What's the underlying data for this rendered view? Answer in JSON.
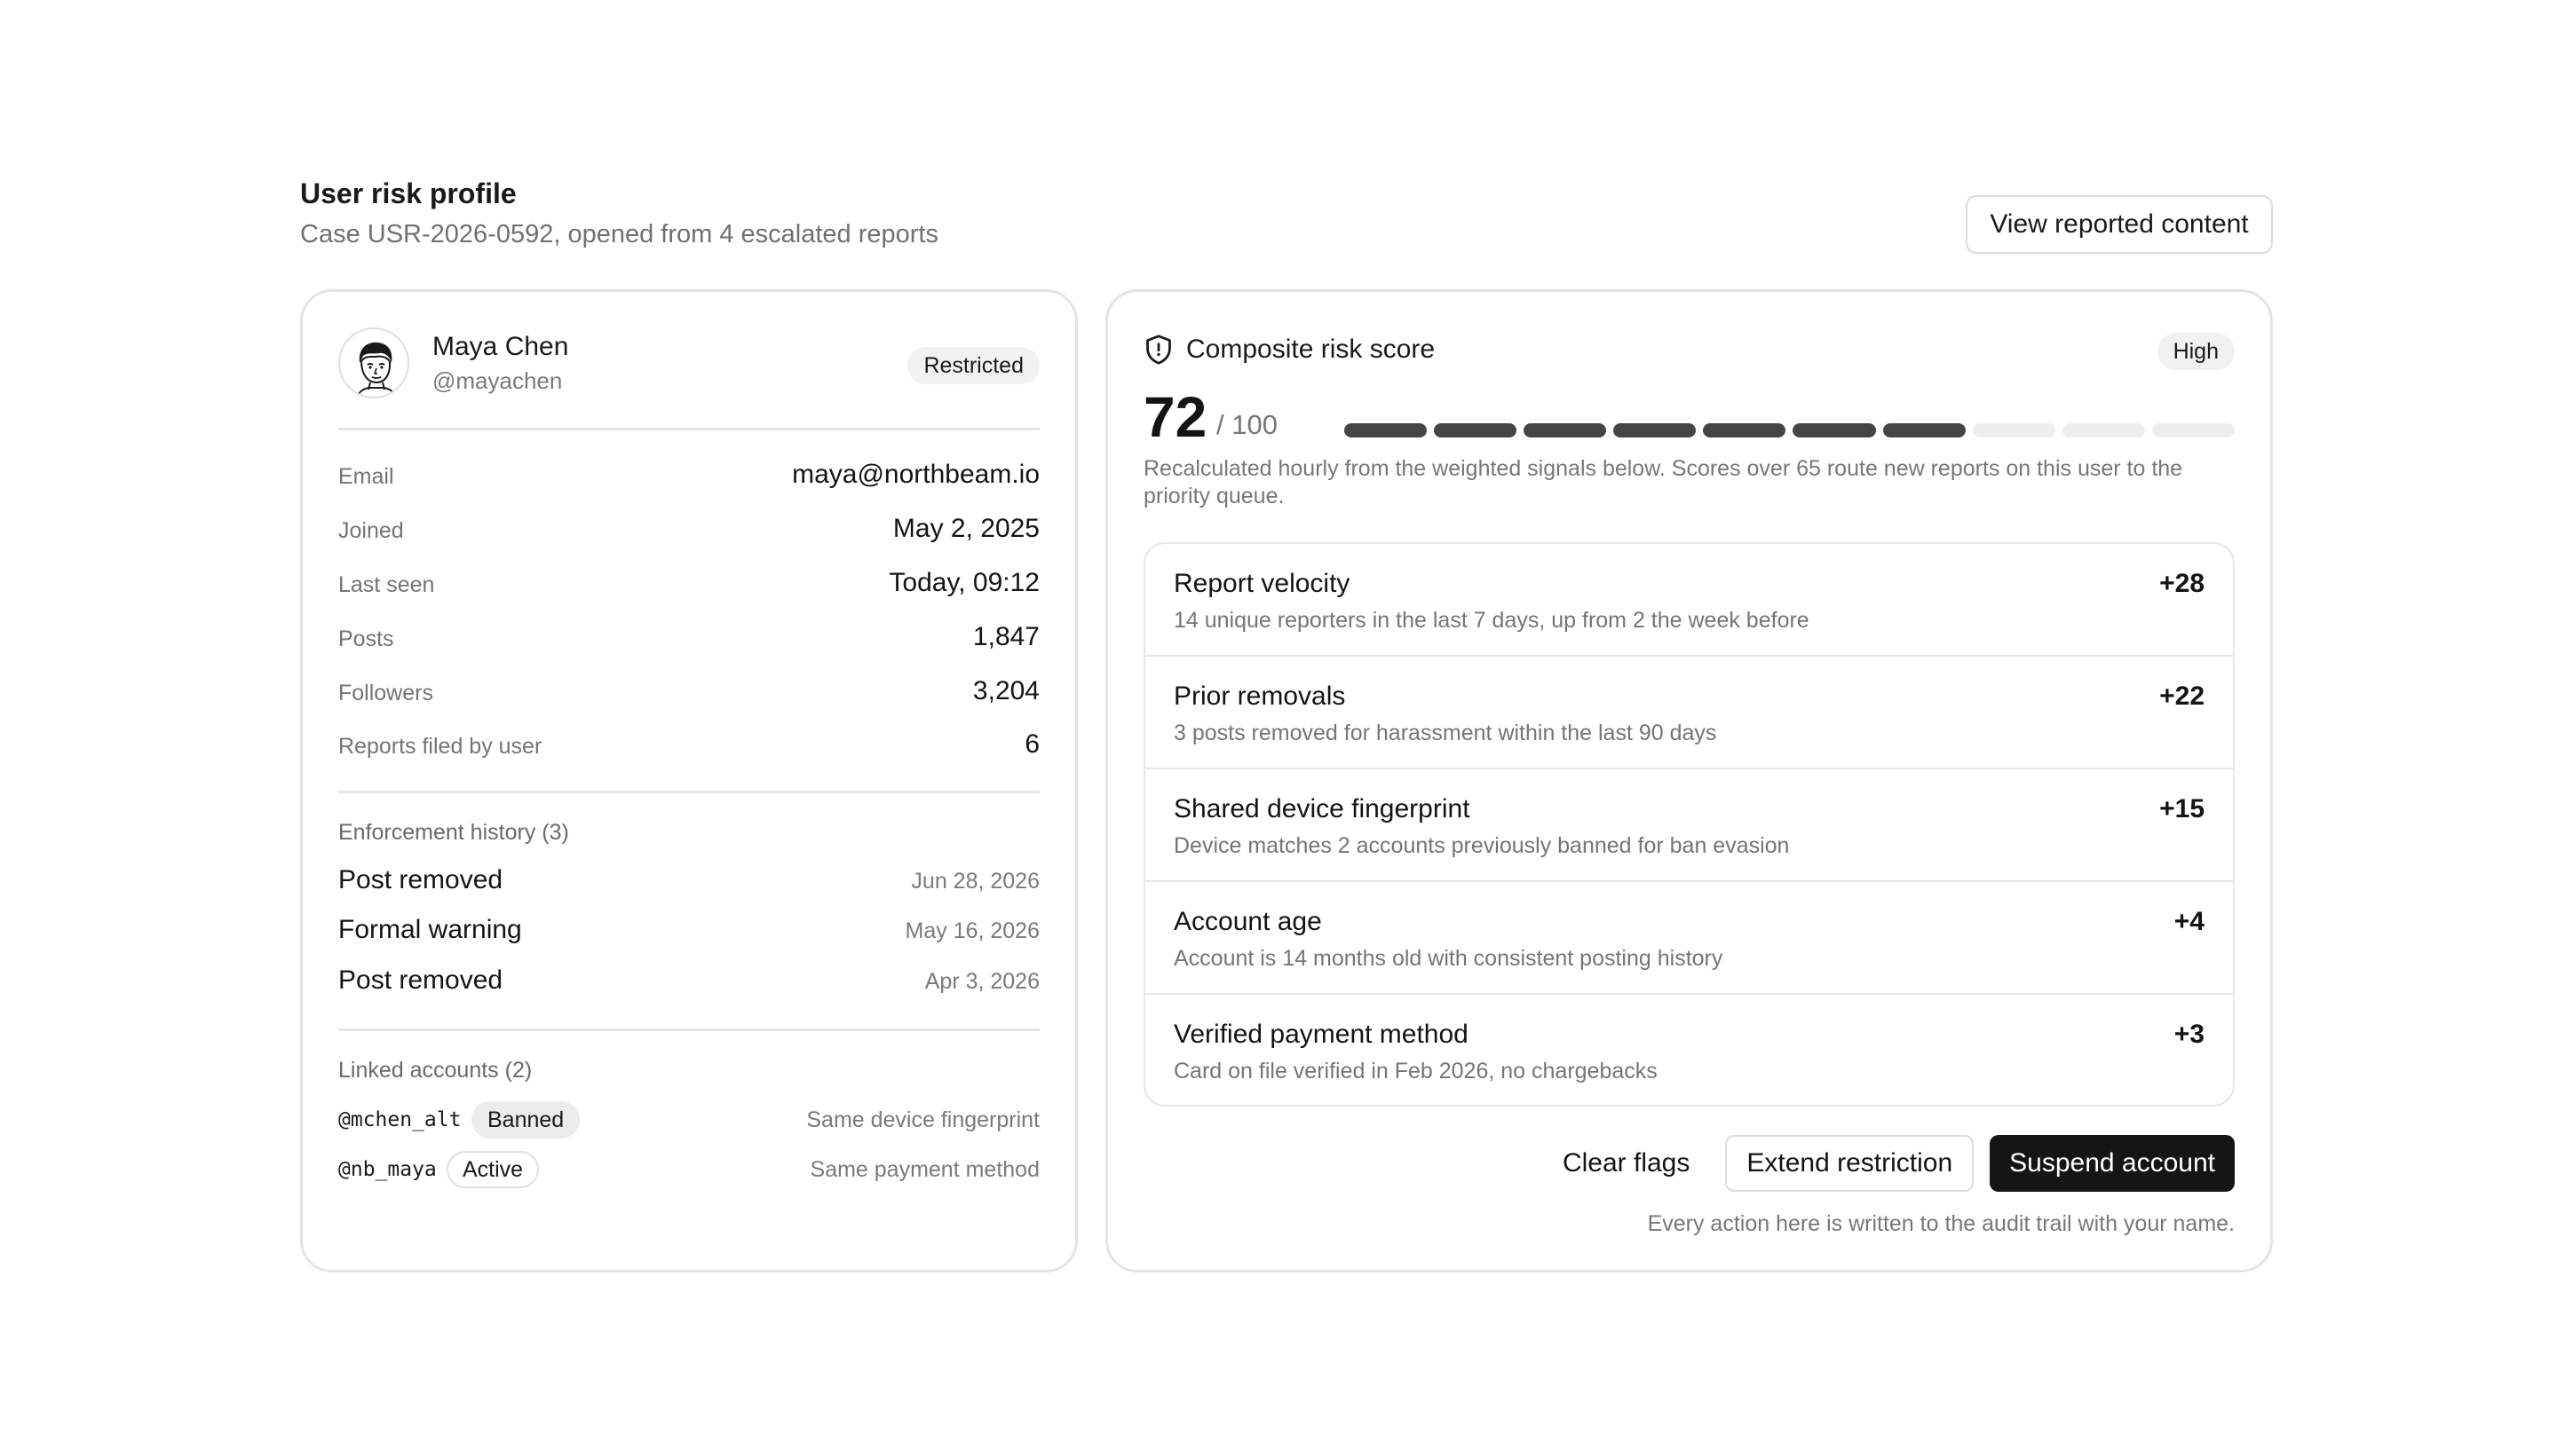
{
  "header": {
    "title": "User risk profile",
    "subtitle": "Case USR-2026-0592, opened from 4 escalated reports",
    "view_button": "View reported content"
  },
  "profile": {
    "name": "Maya Chen",
    "handle": "@mayachen",
    "status": "Restricted",
    "avatar_icon": "person-illustration-icon"
  },
  "details": [
    {
      "label": "Email",
      "value": "maya@northbeam.io"
    },
    {
      "label": "Joined",
      "value": "May 2, 2025"
    },
    {
      "label": "Last seen",
      "value": "Today, 09:12"
    },
    {
      "label": "Posts",
      "value": "1,847"
    },
    {
      "label": "Followers",
      "value": "3,204"
    },
    {
      "label": "Reports filed by user",
      "value": "6"
    }
  ],
  "enforcement": {
    "title": "Enforcement history (3)",
    "items": [
      {
        "action": "Post removed",
        "date": "Jun 28, 2026"
      },
      {
        "action": "Formal warning",
        "date": "May 16, 2026"
      },
      {
        "action": "Post removed",
        "date": "Apr 3, 2026"
      }
    ]
  },
  "linked": {
    "title": "Linked accounts (2)",
    "items": [
      {
        "handle": "@mchen_alt",
        "status": "Banned",
        "reason": "Same device fingerprint"
      },
      {
        "handle": "@nb_maya",
        "status": "Active",
        "reason": "Same payment method"
      }
    ]
  },
  "risk": {
    "title": "Composite risk score",
    "icon": "shield-icon",
    "level": "High",
    "score": "72",
    "max": "/ 100",
    "score_fraction": 0.72,
    "segments_total": 10,
    "segments_filled": 7,
    "note": "Recalculated hourly from the weighted signals below. Scores over 65 route new reports on this user to the priority queue.",
    "signals": [
      {
        "title": "Report velocity",
        "desc": "14 unique reporters in the last 7 days, up from 2 the week before",
        "points": "+28"
      },
      {
        "title": "Prior removals",
        "desc": "3 posts removed for harassment within the last 90 days",
        "points": "+22"
      },
      {
        "title": "Shared device fingerprint",
        "desc": "Device matches 2 accounts previously banned for ban evasion",
        "points": "+15"
      },
      {
        "title": "Account age",
        "desc": "Account is 14 months old with consistent posting history",
        "points": "+4"
      },
      {
        "title": "Verified payment method",
        "desc": "Card on file verified in Feb 2026, no chargebacks",
        "points": "+3"
      }
    ]
  },
  "actions": {
    "clear": "Clear flags",
    "extend": "Extend restriction",
    "suspend": "Suspend account",
    "audit_note": "Every action here is written to the audit trail with your name."
  },
  "colors": {
    "bar_filled": "#454545",
    "bar_empty": "#eeeeee",
    "primary_button": "#151515"
  }
}
